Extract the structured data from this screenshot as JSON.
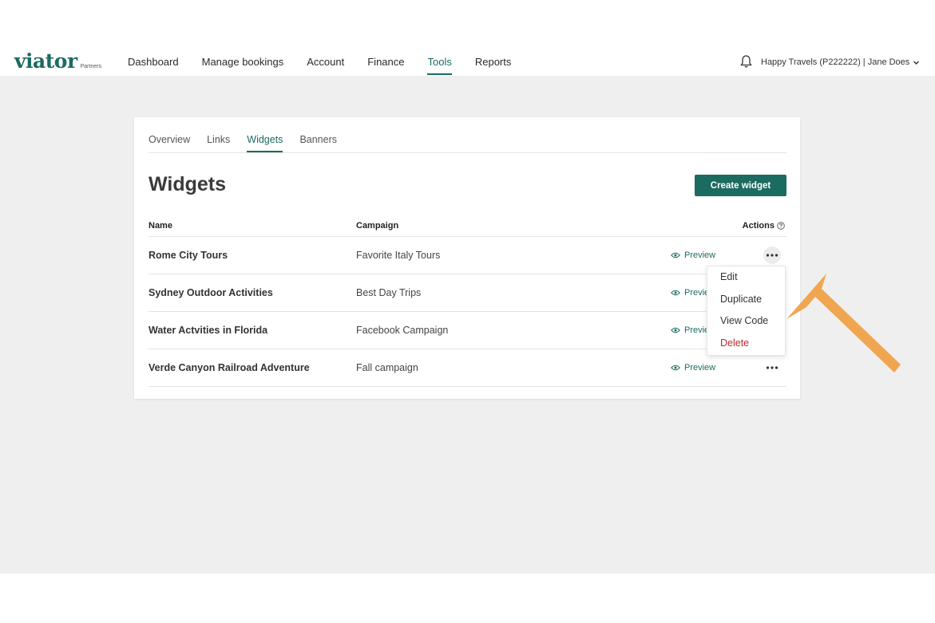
{
  "brand": {
    "name": "viator",
    "sub": "Partners"
  },
  "nav": {
    "items": [
      {
        "label": "Dashboard"
      },
      {
        "label": "Manage bookings"
      },
      {
        "label": "Account"
      },
      {
        "label": "Finance"
      },
      {
        "label": "Tools",
        "active": true
      },
      {
        "label": "Reports"
      }
    ]
  },
  "account": {
    "label": "Happy Travels (P222222)  |  Jane Does"
  },
  "tabs": [
    {
      "label": "Overview"
    },
    {
      "label": "Links"
    },
    {
      "label": "Widgets",
      "active": true
    },
    {
      "label": "Banners"
    }
  ],
  "page": {
    "title": "Widgets",
    "create_label": "Create widget"
  },
  "table": {
    "headers": {
      "name": "Name",
      "campaign": "Campaign",
      "actions": "Actions"
    },
    "preview_label": "Preview",
    "rows": [
      {
        "name": "Rome City Tours",
        "campaign": "Favorite Italy Tours"
      },
      {
        "name": "Sydney Outdoor Activities",
        "campaign": "Best Day Trips"
      },
      {
        "name": "Water Actvities in Florida",
        "campaign": "Facebook Campaign"
      },
      {
        "name": "Verde Canyon Railroad Adventure",
        "campaign": "Fall campaign"
      }
    ]
  },
  "menu": {
    "items": [
      {
        "label": "Edit"
      },
      {
        "label": "Duplicate"
      },
      {
        "label": "View Code"
      },
      {
        "label": "Delete"
      }
    ]
  },
  "colors": {
    "brand": "#1c6b61",
    "danger": "#c0262b",
    "arrow": "#f0a650",
    "page_bg": "#efefef"
  }
}
